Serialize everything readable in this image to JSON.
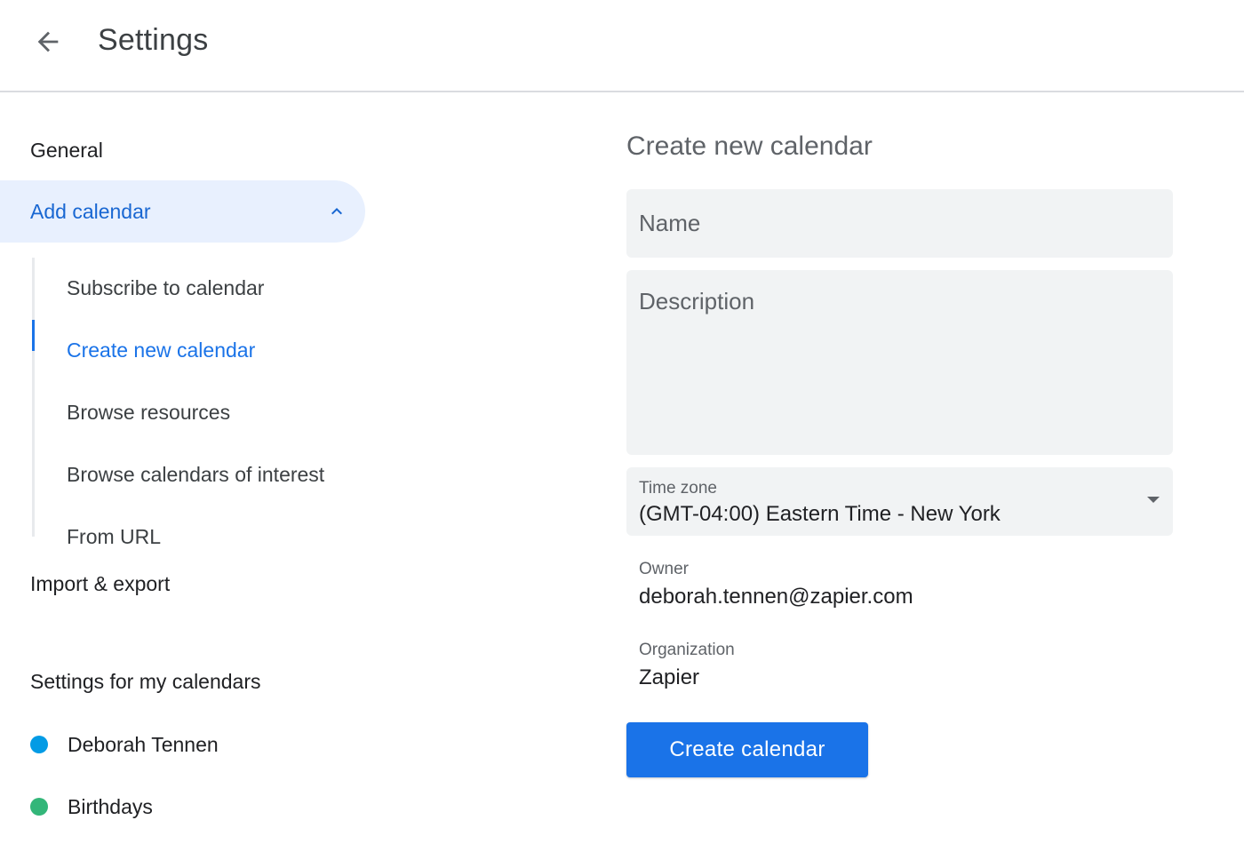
{
  "header": {
    "back_icon": "arrow-back-icon",
    "title": "Settings"
  },
  "sidebar": {
    "general": "General",
    "add_calendar": {
      "label": "Add calendar",
      "icon": "chevron-up-icon",
      "expanded": true,
      "items": [
        {
          "label": "Subscribe to calendar",
          "active": false
        },
        {
          "label": "Create new calendar",
          "active": true
        },
        {
          "label": "Browse resources",
          "active": false
        },
        {
          "label": "Browse calendars of interest",
          "active": false
        },
        {
          "label": "From URL",
          "active": false
        }
      ]
    },
    "import_export": "Import & export",
    "my_calendars_heading": "Settings for my calendars",
    "my_calendars": [
      {
        "label": "Deborah Tennen",
        "color": "#039be5"
      },
      {
        "label": "Birthdays",
        "color": "#33b679"
      }
    ]
  },
  "main": {
    "title": "Create new calendar",
    "name_placeholder": "Name",
    "description_placeholder": "Description",
    "timezone": {
      "label": "Time zone",
      "value": "(GMT-04:00) Eastern Time - New York",
      "icon": "dropdown-arrow-icon"
    },
    "owner": {
      "label": "Owner",
      "value": "deborah.tennen@zapier.com"
    },
    "organization": {
      "label": "Organization",
      "value": "Zapier"
    },
    "create_button": "Create calendar"
  },
  "colors": {
    "accent": "#1a73e8",
    "active_bg": "#e8f0fe"
  }
}
